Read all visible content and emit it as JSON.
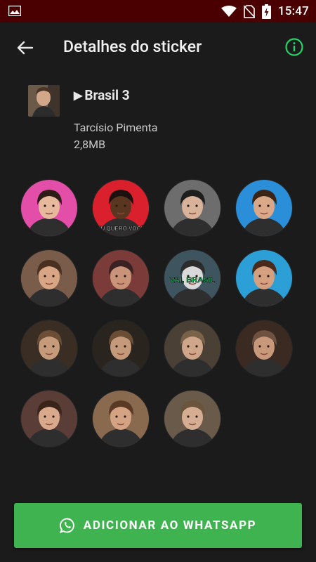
{
  "status_bar": {
    "time": "15:47",
    "left_icon": "image-icon",
    "right_icons": [
      "wifi-icon",
      "no-sim-icon",
      "battery-charging-icon"
    ]
  },
  "toolbar": {
    "title": "Detalhes do sticker",
    "back_icon": "arrow-left-icon",
    "info_icon": "info-icon",
    "accent": "#25d366"
  },
  "pack": {
    "play_icon": "▶",
    "name": "Brasil 3",
    "author": "Tarcísio Pimenta",
    "size": "2,8MB"
  },
  "stickers": [
    {
      "label": "",
      "bg": "#e34fa8",
      "skin": "#e7b99c",
      "hair": "#2d1b16",
      "overlay": ""
    },
    {
      "label": "",
      "bg": "#d9202c",
      "skin": "#5a3621",
      "hair": "#1b1210",
      "overlay": "EU QUERO VOCÊ"
    },
    {
      "label": "",
      "bg": "#6d6d6d",
      "skin": "#d8b39a",
      "hair": "#1e1e1e",
      "overlay": ""
    },
    {
      "label": "",
      "bg": "#2a8fd8",
      "skin": "#d9a889",
      "hair": "#3b2416",
      "overlay": ""
    },
    {
      "label": "",
      "bg": "#7a5c4a",
      "skin": "#d8a585",
      "hair": "#4a3020",
      "overlay": ""
    },
    {
      "label": "",
      "bg": "#7b3b38",
      "skin": "#c9937a",
      "hair": "#3a2222",
      "overlay": ""
    },
    {
      "label": "",
      "bg": "#3e5560",
      "skin": "#d9d9d9",
      "hair": "#2c2c2c",
      "overlay": "VAI, BRASIL"
    },
    {
      "label": "",
      "bg": "#2b9fd6",
      "skin": "#d4a07f",
      "hair": "#4a2a1a",
      "overlay": ""
    },
    {
      "label": "",
      "bg": "#3a2e24",
      "skin": "#c59b7c",
      "hair": "#6b4e35",
      "overlay": ""
    },
    {
      "label": "",
      "bg": "#2a241e",
      "skin": "#c49a7b",
      "hair": "#6a4d33",
      "overlay": ""
    },
    {
      "label": "",
      "bg": "#4a4036",
      "skin": "#cfa68a",
      "hair": "#7a6248",
      "overlay": ""
    },
    {
      "label": "",
      "bg": "#3a2a22",
      "skin": "#c8987a",
      "hair": "#6e5240",
      "overlay": ""
    },
    {
      "label": "",
      "bg": "#5a3d36",
      "skin": "#d8a98c",
      "hair": "#3a2419",
      "overlay": ""
    },
    {
      "label": "",
      "bg": "#8a6a4e",
      "skin": "#d3a384",
      "hair": "#5a3a24",
      "overlay": ""
    },
    {
      "label": "",
      "bg": "#6a5a4a",
      "skin": "#d5ad93",
      "hair": "#6a543c",
      "overlay": ""
    }
  ],
  "add_button": {
    "label": "ADICIONAR AO WHATSAPP",
    "icon": "whatsapp-icon",
    "color": "#3fb34f"
  }
}
